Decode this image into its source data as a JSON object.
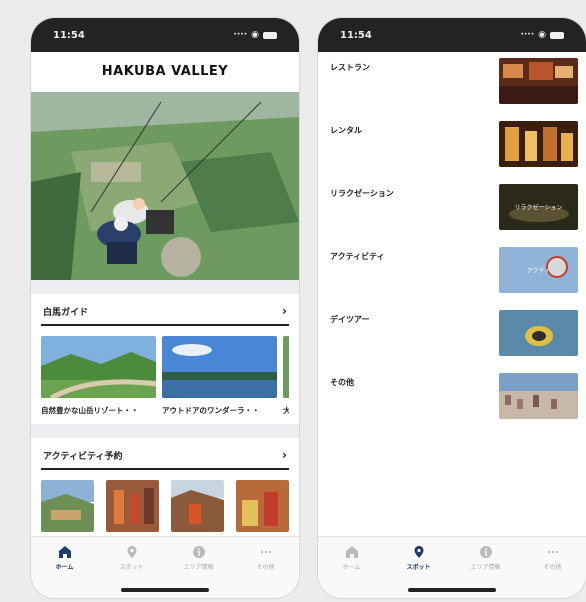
{
  "status_time": "11:54",
  "left": {
    "app_title": "HAKUBA VALLEY",
    "guide_section": {
      "title": "白馬ガイド",
      "cards": [
        {
          "caption": "自然豊かな山岳リゾート・・"
        },
        {
          "caption": "アウトドアのワンダーラ・・"
        },
        {
          "caption": "大人"
        }
      ]
    },
    "activity_section": {
      "title": "アクティビティ予約"
    }
  },
  "right": {
    "categories": [
      {
        "label": "レストラン"
      },
      {
        "label": "レンタル"
      },
      {
        "label": "リラクゼーション",
        "thumb_text": "リラクゼーション"
      },
      {
        "label": "アクティビティ",
        "thumb_text": "アクティ"
      },
      {
        "label": "デイツアー"
      },
      {
        "label": "その他"
      }
    ]
  },
  "tabbar": {
    "tabs": [
      {
        "label": "ホーム",
        "icon": "home-icon"
      },
      {
        "label": "スポット",
        "icon": "location-pin-icon"
      },
      {
        "label": "エリア情報",
        "icon": "info-icon"
      },
      {
        "label": "その他",
        "icon": "more-icon"
      }
    ]
  },
  "colors": {
    "accent": "#1f3a6e",
    "status_bar": "#232323"
  }
}
